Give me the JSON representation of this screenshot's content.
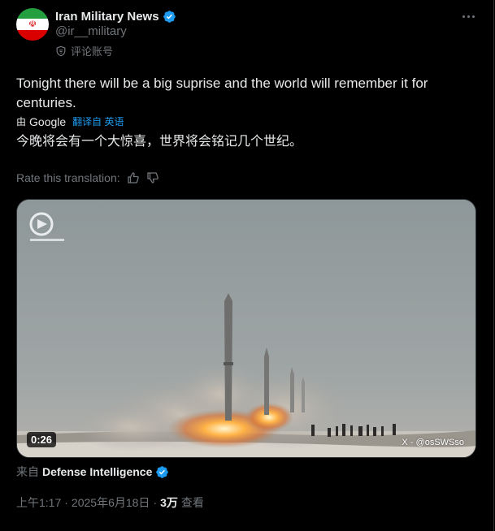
{
  "author": {
    "name": "Iran Military News",
    "handle": "@ir__military",
    "label": "评论账号"
  },
  "tweet": {
    "text": "Tonight there will be a big suprise and the world will remember it for centuries.",
    "translated_by_prefix": "由",
    "translator": "Google",
    "translated_from": "翻译自 英语",
    "translation": "今晚将会有一个大惊喜，世界将会铭记几个世纪。",
    "rate_prompt": "Rate this translation:"
  },
  "media": {
    "duration": "0:26",
    "watermark": "X - @osSWSso"
  },
  "source": {
    "prefix": "来自",
    "name": "Defense Intelligence"
  },
  "meta": {
    "time": "上午1:17",
    "separator": "·",
    "date": "2025年6月18日",
    "views_count": "3万",
    "views_label": "查看"
  },
  "colors": {
    "background": "#000000",
    "text": "#e7e9ea",
    "muted": "#71767b",
    "accent": "#1d9bf0"
  },
  "icons": {
    "verified": "verified-badge-icon",
    "label": "shield-icon",
    "more": "more-dots-icon",
    "thumbs_up": "thumbs-up-icon",
    "thumbs_down": "thumbs-down-icon"
  }
}
